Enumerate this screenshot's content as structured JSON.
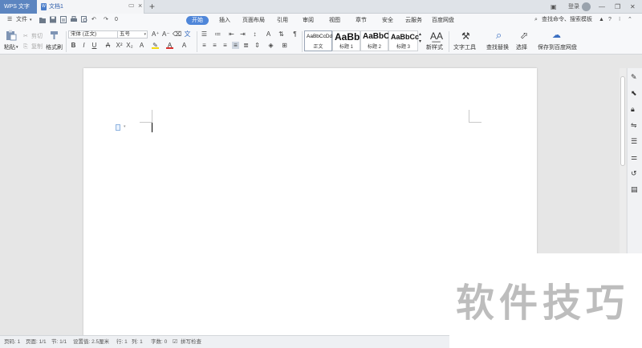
{
  "titlebar": {
    "app_name": "WPS 文字",
    "doc_title": "文档1",
    "new_tab": "+",
    "login": "登录"
  },
  "menubar": {
    "file": "文件",
    "undo_count": "0",
    "tabs": [
      {
        "label": "开始",
        "active": true
      },
      {
        "label": "插入"
      },
      {
        "label": "页面布局"
      },
      {
        "label": "引用"
      },
      {
        "label": "审阅"
      },
      {
        "label": "视图"
      },
      {
        "label": "章节"
      },
      {
        "label": "安全"
      },
      {
        "label": "云服务"
      },
      {
        "label": "百度网盘"
      }
    ],
    "search_placeholder": "查找命令、搜索模板"
  },
  "ribbon": {
    "paste": "粘贴",
    "cut": "剪切",
    "copy": "复制",
    "format_painter": "格式刷",
    "font_name": "宋体 (正文)",
    "font_size": "五号",
    "styles": [
      {
        "sample": "AaBbCcDd",
        "name": "正文"
      },
      {
        "sample": "AaBb",
        "name": "标题 1"
      },
      {
        "sample": "AaBbC",
        "name": "标题 2"
      },
      {
        "sample": "AaBbCc",
        "name": "标题 3"
      }
    ],
    "new_style": "新样式",
    "text_tools": "文字工具",
    "find_replace": "查找替换",
    "select": "选择",
    "save_baidu": "保存到百度网盘"
  },
  "statusbar": {
    "page_no": "页码: 1",
    "pages": "页面: 1/1",
    "section": "节: 1/1",
    "setting": "设置值: 2.5厘米",
    "row": "行: 1",
    "col": "列: 1",
    "words": "字数: 0",
    "spell": "拼写检查"
  },
  "watermark": {
    "text": "软件技巧"
  },
  "colors": {
    "accent": "#4f86d9",
    "app_tab": "#5c85c0",
    "font_color_red": "#d9302c",
    "highlight_yellow": "#f5d90a"
  }
}
